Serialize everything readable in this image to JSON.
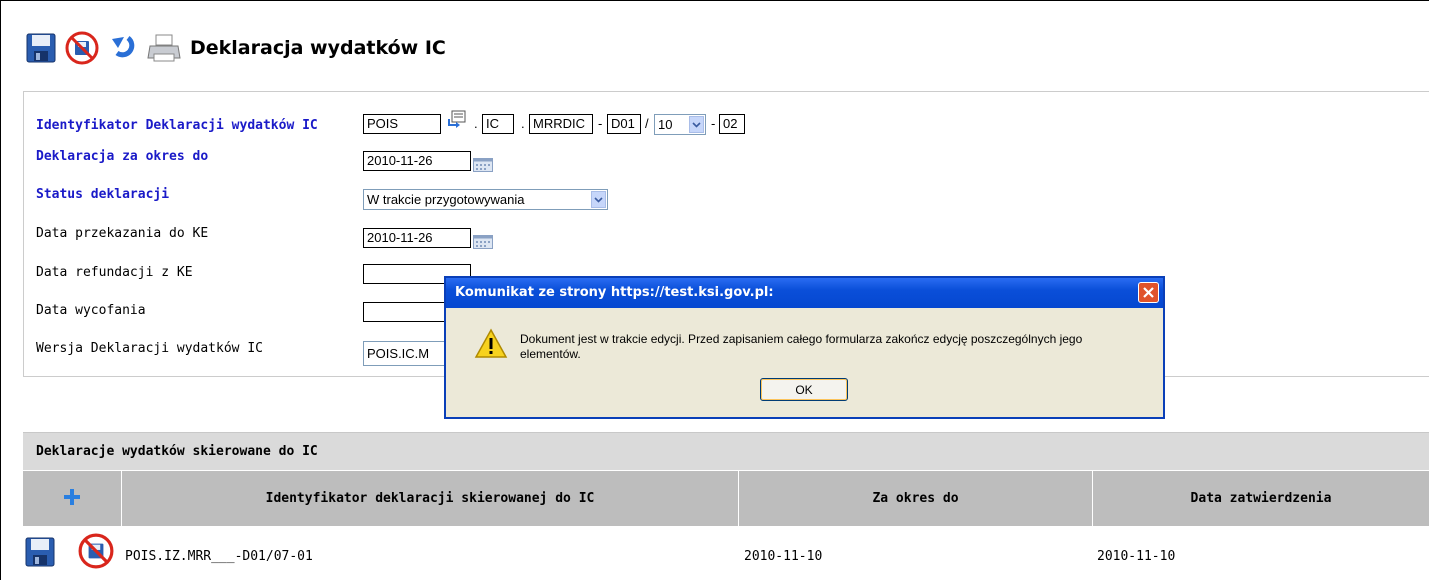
{
  "page": {
    "title": "Deklaracja wydatków IC"
  },
  "toolbar": {
    "icons": [
      "save-icon",
      "cancel-icon",
      "undo-icon",
      "print-icon"
    ]
  },
  "form": {
    "identifier": {
      "label": "Identyfikator Deklaracji wydatków IC",
      "part1": "POIS",
      "part2": "IC",
      "part3": "MRRDIC",
      "part4": "D01",
      "month_selected": "10",
      "part6": "02",
      "sep_dot": ".",
      "sep_dash": "-",
      "sep_slash": "/"
    },
    "period_to": {
      "label": "Deklaracja za okres do",
      "value": "2010-11-26"
    },
    "status": {
      "label": "Status deklaracji",
      "value": "W trakcie przygotowywania"
    },
    "transfer_date": {
      "label": "Data przekazania do KE",
      "value": "2010-11-26"
    },
    "refund_date": {
      "label": "Data refundacji z KE",
      "value": ""
    },
    "withdraw_date": {
      "label": "Data wycofania",
      "value": ""
    },
    "version": {
      "label": "Wersja Deklaracji wydatków IC",
      "value": "POIS.IC.M"
    }
  },
  "grid": {
    "title": "Deklaracje wydatków skierowane do IC",
    "columns": [
      "Identyfikator deklaracji skierowanej do IC",
      "Za okres do",
      "Data zatwierdzenia"
    ],
    "rows": [
      {
        "identifier": "POIS.IZ.MRR___-D01/07-01",
        "period_to": "2010-11-10",
        "approval_date": "2010-11-10"
      }
    ]
  },
  "dialog": {
    "title": "Komunikat ze strony https://test.ksi.gov.pl:",
    "message": "Dokument jest w trakcie edycji. Przed zapisaniem całego formularza zakończ edycję poszczególnych jego elementów.",
    "ok_label": "OK"
  },
  "colors": {
    "required_label": "#1a1ac8",
    "titlebar": "#0a4fd9",
    "dialog_bg": "#ece9d8"
  }
}
